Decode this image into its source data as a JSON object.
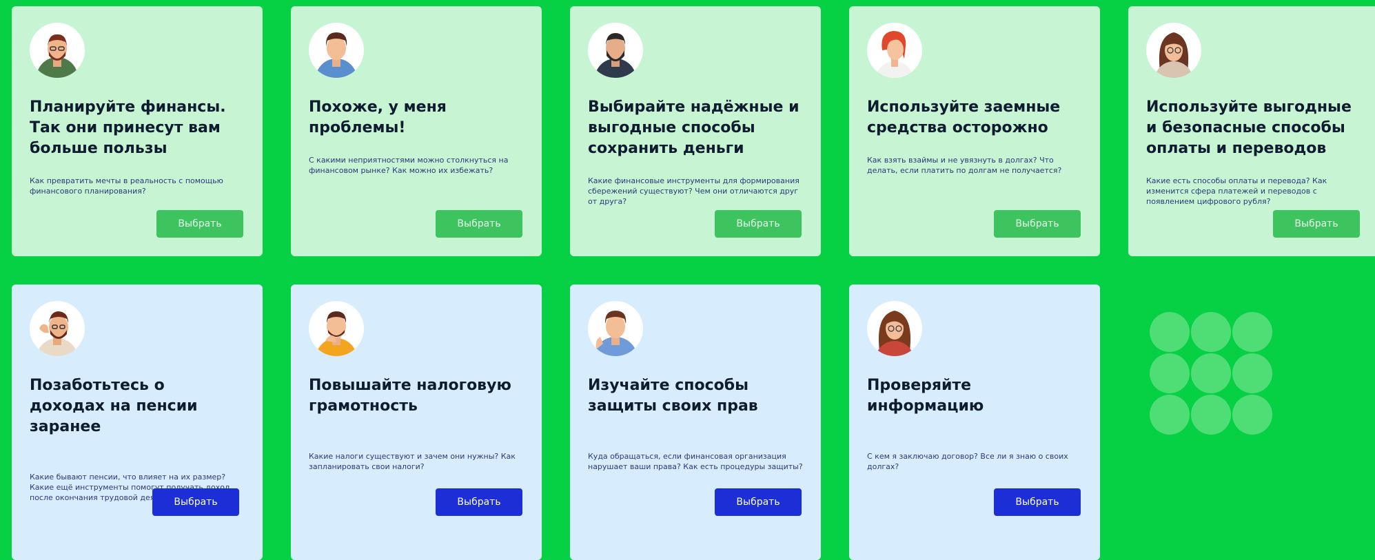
{
  "button_label": "Выбрать",
  "colors": {
    "background": "#06d043",
    "card_green": "#c7f4d3",
    "card_blue": "#d7ecfd",
    "button_green": "#3dc45e",
    "button_blue": "#1c2fd6"
  },
  "row1": [
    {
      "avatar": "man-beard-glasses-green-sweater",
      "title": "Планируйте финансы. Так они принесут вам больше пользы",
      "desc": "Как превратить мечты в реальность с помощью финансового планирования?"
    },
    {
      "avatar": "man-short-hair-blue-shirt",
      "title": "Похоже, у меня проблемы!",
      "desc": "С какими неприятностями можно столкнуться на финансовом рынке? Как можно их избежать?"
    },
    {
      "avatar": "man-beard-dark-jacket",
      "title": "Выбирайте надёжные и выгодные способы сохранить деньги",
      "desc": "Какие финансовые инструменты для формирования сбережений существуют? Чем они отличаются друг от друга?"
    },
    {
      "avatar": "woman-red-hair",
      "title": "Используйте заемные средства осторожно",
      "desc": "Как взять взаймы и не увязнуть в долгах? Что делать, если платить по долгам не получается?"
    },
    {
      "avatar": "woman-long-hair-glasses",
      "title": "Используйте выгодные и безопасные способы оплаты и переводов",
      "desc": "Какие есть способы оплаты и перевода? Как изменится сфера платежей и переводов с появлением цифрового рубля?"
    }
  ],
  "row2": [
    {
      "avatar": "man-beard-hand-glasses",
      "title": "Позаботьтесь о доходах на пенсии заранее",
      "desc": "Какие бывают пенсии, что влияет на их размер? Какие ещё инструменты помогут получать доход после окончания трудовой деятельности?"
    },
    {
      "avatar": "man-thinking-orange-shirt",
      "title": "Повышайте налоговую грамотность",
      "desc": "Какие налоги существуют и зачем они нужны? Как запланировать свои налоги?"
    },
    {
      "avatar": "man-pointing-blue-shirt",
      "title": "Изучайте способы защиты своих прав",
      "desc": "Куда обращаться, если финансовая организация нарушает ваши права? Как есть процедуры защиты?"
    },
    {
      "avatar": "woman-brown-hair-glasses",
      "title": "Проверяйте информацию",
      "desc": "С кем я заключаю договор? Все ли я знаю о своих долгах?"
    }
  ]
}
